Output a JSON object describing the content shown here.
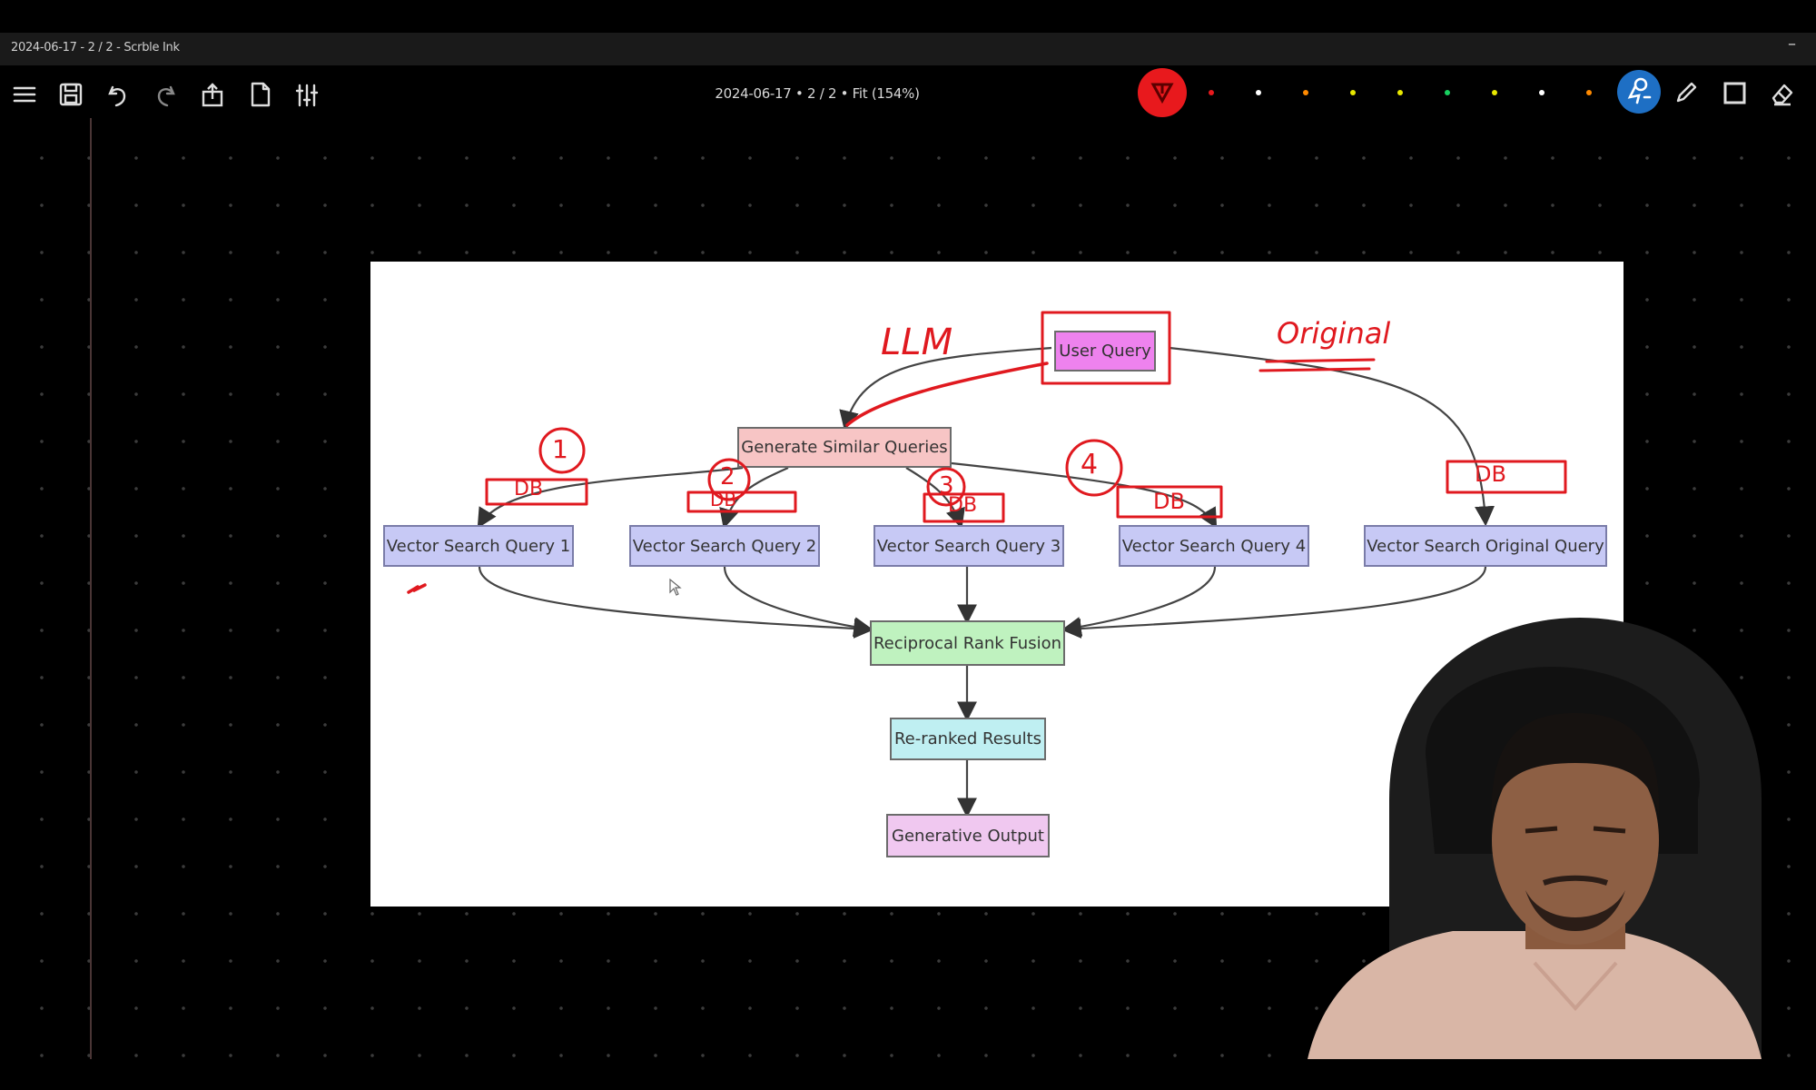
{
  "window": {
    "title": "2024-06-17 - 2 / 2 - Scrble Ink"
  },
  "toolbar": {
    "document_info": "2024-06-17  •  2 / 2  •  Fit (154%)",
    "icons": [
      "menu-icon",
      "save-icon",
      "undo-icon",
      "redo-icon",
      "share-icon",
      "page-icon",
      "settings-icon"
    ],
    "palette_colors": [
      "#e8191d",
      "#e8191d",
      "#ffffff",
      "#ff8a00",
      "#e8e800",
      "#e8e800",
      "#18d060",
      "#e8e800",
      "#ffffff",
      "#ff8a00"
    ],
    "tools": [
      "lasso-icon",
      "pencil-icon",
      "shape-icon",
      "eraser-icon"
    ]
  },
  "diagram": {
    "nodes": {
      "user_query": "User Query",
      "generate": "Generate Similar Queries",
      "vq1": "Vector Search Query 1",
      "vq2": "Vector Search Query 2",
      "vq3": "Vector Search Query 3",
      "vq4": "Vector Search Query 4",
      "vqo": "Vector Search Original Query",
      "rrf": "Reciprocal Rank Fusion",
      "reranked": "Re-ranked Results",
      "output": "Generative Output"
    },
    "colors": {
      "user_query": "#ee82ee",
      "generate": "#f7c5c5",
      "vector": "#c7c9f5",
      "rrf": "#bff2bf",
      "reranked": "#bfeff2",
      "output": "#f0c8f0",
      "annotation": "#e0191f"
    }
  },
  "annotations": {
    "llm": "LLM",
    "original": "Original",
    "n1": "1",
    "n2": "2",
    "n3": "3",
    "n4": "4",
    "db": "DB"
  }
}
